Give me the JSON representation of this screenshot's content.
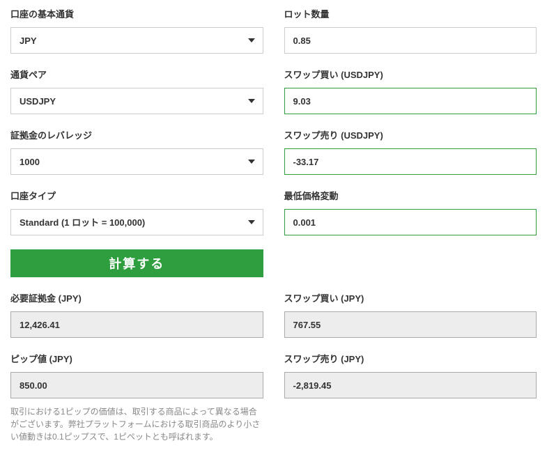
{
  "left": {
    "base_currency": {
      "label": "口座の基本通貨",
      "value": "JPY"
    },
    "currency_pair": {
      "label": "通貨ペア",
      "value": "USDJPY"
    },
    "leverage": {
      "label": "証拠金のレバレッジ",
      "value": "1000"
    },
    "account_type": {
      "label": "口座タイプ",
      "value": "Standard (1 ロット = 100,000)"
    },
    "calculate_button": "計算する",
    "required_margin": {
      "label": "必要証拠金 (JPY)",
      "value": "12,426.41"
    },
    "pip_value": {
      "label": "ピップ値 (JPY)",
      "value": "850.00"
    },
    "note": "取引における1ピップの価値は、取引する商品によって異なる場合がございます。弊社プラットフォームにおける取引商品のより小さい値動きは0.1ピップスで、1ピペットとも呼ばれます。"
  },
  "right": {
    "lot_size": {
      "label": "ロット数量",
      "value": "0.85"
    },
    "swap_buy_usdjpy": {
      "label": "スワップ買い (USDJPY)",
      "value": "9.03"
    },
    "swap_sell_usdjpy": {
      "label": "スワップ売り (USDJPY)",
      "value": "-33.17"
    },
    "min_price_move": {
      "label": "最低価格変動",
      "value": "0.001"
    },
    "swap_buy_jpy": {
      "label": "スワップ買い (JPY)",
      "value": "767.55"
    },
    "swap_sell_jpy": {
      "label": "スワップ売り (JPY)",
      "value": "-2,819.45"
    }
  }
}
